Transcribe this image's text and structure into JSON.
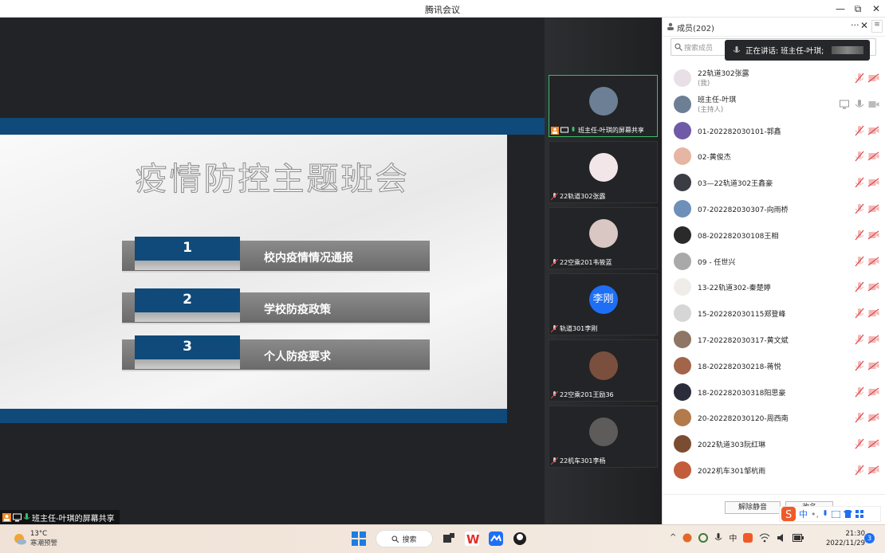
{
  "window": {
    "title": "腾讯会议",
    "controls": [
      "—",
      "⧉",
      "✕"
    ]
  },
  "slide": {
    "title": "疫情防控主题班会",
    "items": [
      {
        "num": "1",
        "text": "校内疫情情况通报"
      },
      {
        "num": "2",
        "text": "学校防疫政策"
      },
      {
        "num": "3",
        "text": "个人防疫要求"
      }
    ]
  },
  "stage_footer": {
    "label": "班主任-叶琪的屏幕共享"
  },
  "video_tiles": [
    {
      "label": "班主任-叶琪的屏幕共享",
      "avatar_color": "#6c7f95",
      "active": true
    },
    {
      "label": "22轨道302张露",
      "avatar_color": "#f3e6e9"
    },
    {
      "label": "22空乘201韦筱蓝",
      "avatar_color": "#d9c7c3"
    },
    {
      "label": "轨道301李刚",
      "avatar_text": "李刚"
    },
    {
      "label": "22空乘201王励36",
      "avatar_color": "#7a4f3d"
    },
    {
      "label": "22机车301李杨",
      "avatar_color": "#5d5c5a"
    }
  ],
  "panel": {
    "title": "成员(202)",
    "more": "···",
    "close": "✕",
    "menu": "≡",
    "search_placeholder": "搜索成员",
    "speaking": "正在讲话: 班主任-叶琪;",
    "members": [
      {
        "name": "22轨道302张露",
        "sub": "(我)",
        "color": "#e9dfe6"
      },
      {
        "name": "班主任-叶琪",
        "sub": "(主持人)",
        "color": "#6c7f95",
        "host": true
      },
      {
        "name": "01-202282030101-郭鑫",
        "color": "#6f5aa8"
      },
      {
        "name": "02-黄俊杰",
        "color": "#e7b5a3"
      },
      {
        "name": "03—22轨道302王鑫豪",
        "color": "#3b3d44"
      },
      {
        "name": "07-202282030307-向雨桥",
        "color": "#6e8fb8"
      },
      {
        "name": "08-202282030108王相",
        "color": "#2a2a2a"
      },
      {
        "name": "09 - 任世兴",
        "color": "#a9a9a9"
      },
      {
        "name": "13-22轨道302-秦楚婷",
        "color": "#f0ece8"
      },
      {
        "name": "15-202282030115郑登峰",
        "color": "#d6d6d6"
      },
      {
        "name": "17-202282030317-黄文斌",
        "color": "#8f7565"
      },
      {
        "name": "18-202282030218-蒋悦",
        "color": "#a2654a"
      },
      {
        "name": "18-202282030318阳思豪",
        "color": "#2a2c3a"
      },
      {
        "name": "20-202282030120-周西南",
        "color": "#b37a4c"
      },
      {
        "name": "2022轨道303阮红琳",
        "color": "#7a4d32"
      },
      {
        "name": "2022机车301邹杭雨",
        "color": "#c25d3b"
      }
    ],
    "btn_unmute": "解除静音",
    "btn_rename": "改名",
    "ime_label": "中"
  },
  "taskbar": {
    "temp": "13°C",
    "weather": "寒潮预警",
    "search": "搜索",
    "time": "21:30",
    "date": "2022/11/29",
    "notif_count": "3"
  }
}
